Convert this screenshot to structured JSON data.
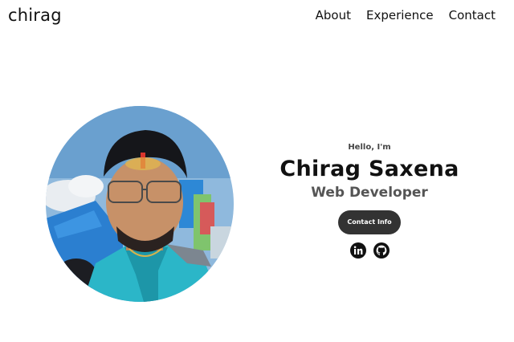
{
  "nav": {
    "logo": "chirag",
    "links": [
      "About",
      "Experience",
      "Contact"
    ]
  },
  "hero": {
    "greeting": "Hello, I'm",
    "name": "Chirag Saxena",
    "role": "Web Developer",
    "contact_button": "Contact Info",
    "socials": [
      "linkedin-icon",
      "github-icon"
    ]
  },
  "colors": {
    "text": "#111111",
    "button_bg": "#333333",
    "button_text": "#ffffff",
    "subtitle": "#555555"
  }
}
